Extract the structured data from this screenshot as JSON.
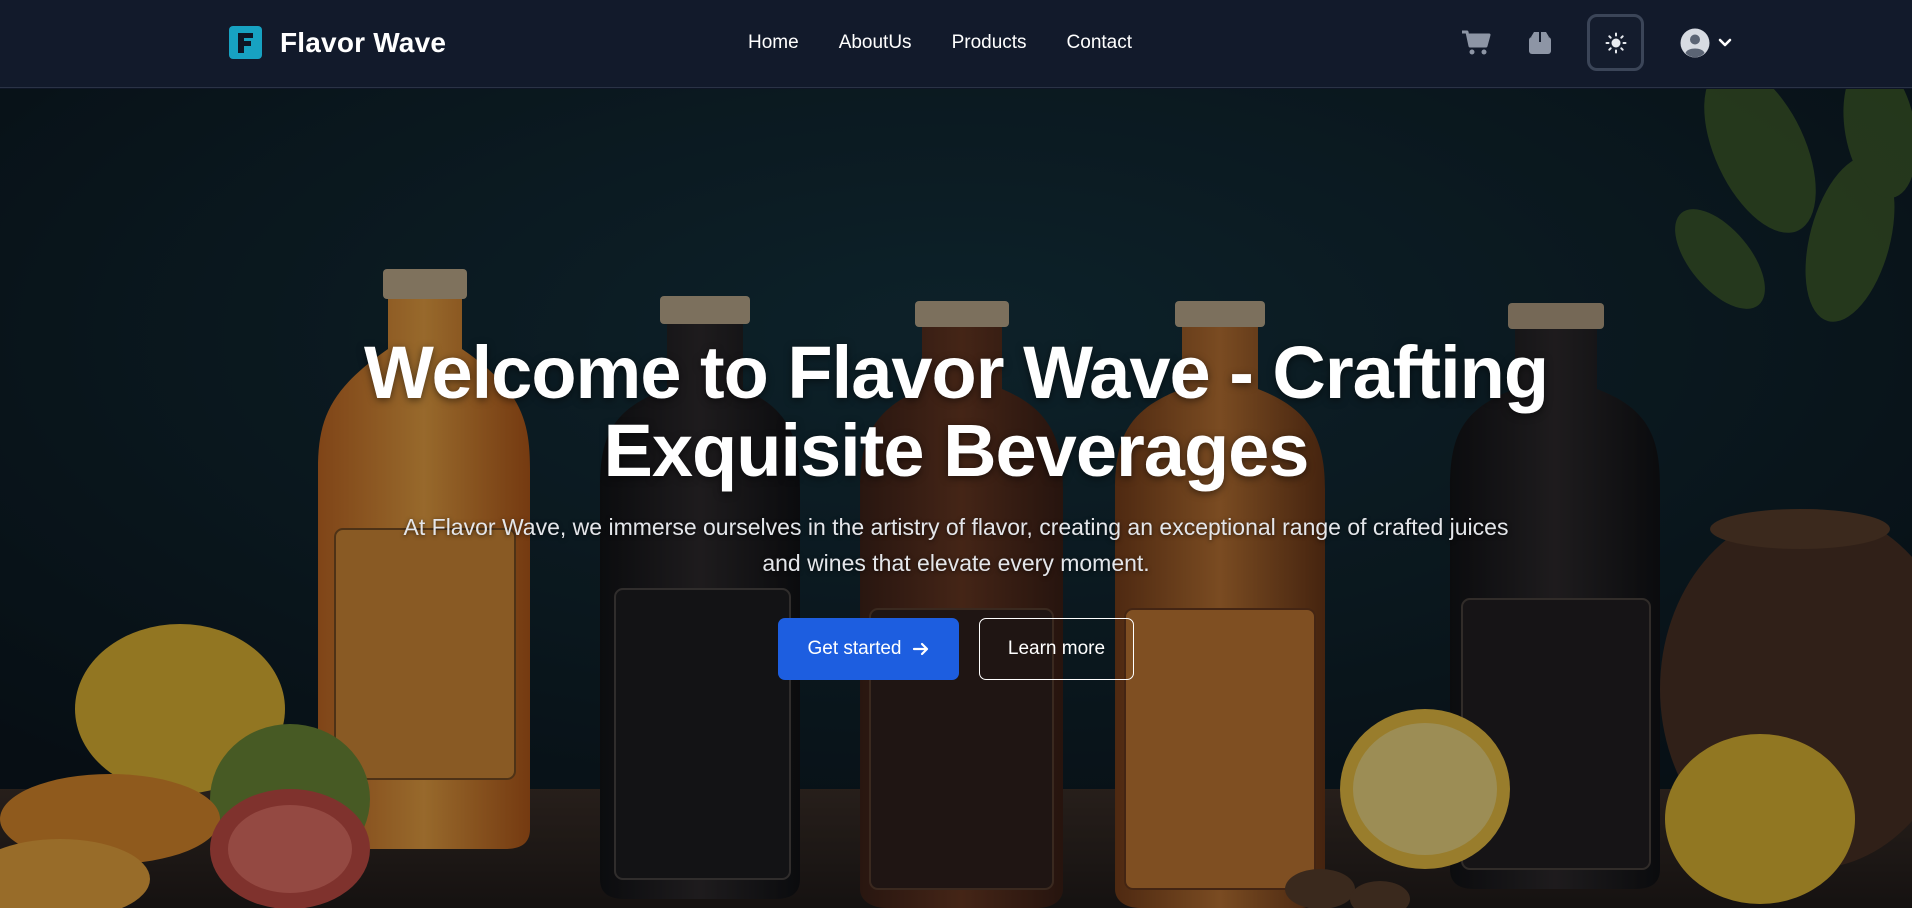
{
  "brand": {
    "name": "Flavor Wave",
    "logo_letter": "F"
  },
  "nav": {
    "items": [
      {
        "label": "Home"
      },
      {
        "label": "AboutUs"
      },
      {
        "label": "Products"
      },
      {
        "label": "Contact"
      }
    ],
    "icons": [
      "cart-icon",
      "package-icon",
      "sun-icon",
      "user-avatar-icon",
      "chevron-down-icon"
    ]
  },
  "hero": {
    "title": "Welcome to Flavor Wave - Crafting Exquisite Beverages",
    "subtitle": "At Flavor Wave, we immerse ourselves in the artistry of flavor, creating an exceptional range of crafted juices and wines that elevate every moment.",
    "primary_cta": "Get started",
    "secondary_cta": "Learn more"
  },
  "colors": {
    "nav_bg": "#121a2b",
    "accent": "#1d5ee0",
    "logo": "#17a2c2"
  }
}
